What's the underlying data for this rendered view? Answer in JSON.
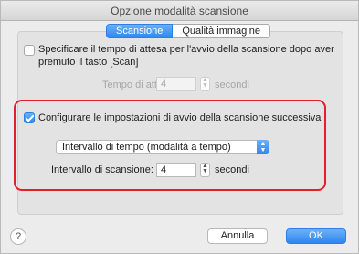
{
  "window": {
    "title": "Opzione modalità scansione"
  },
  "tabs": [
    {
      "label": "Scansione",
      "selected": true
    },
    {
      "label": "Qualità immagine",
      "selected": false
    }
  ],
  "wait_section": {
    "checkbox_checked": false,
    "label_line1": "Specificare il tempo di attesa per l'avvio della scansione dopo aver",
    "label_line2": "premuto il tasto [Scan]",
    "wait_label": "Tempo di attesa:",
    "wait_value": "4",
    "wait_unit": "secondi"
  },
  "next_scan_section": {
    "checkbox_checked": true,
    "label": "Configurare le impostazioni di avvio della scansione successiva",
    "mode_selected": "Intervallo di tempo (modalità a tempo)",
    "interval_label": "Intervallo di scansione:",
    "interval_value": "4",
    "interval_unit": "secondi"
  },
  "footer": {
    "help_label": "?",
    "cancel_label": "Annulla",
    "ok_label": "OK"
  },
  "colors": {
    "accent": "#2f86f0",
    "highlight": "#e0202a"
  }
}
